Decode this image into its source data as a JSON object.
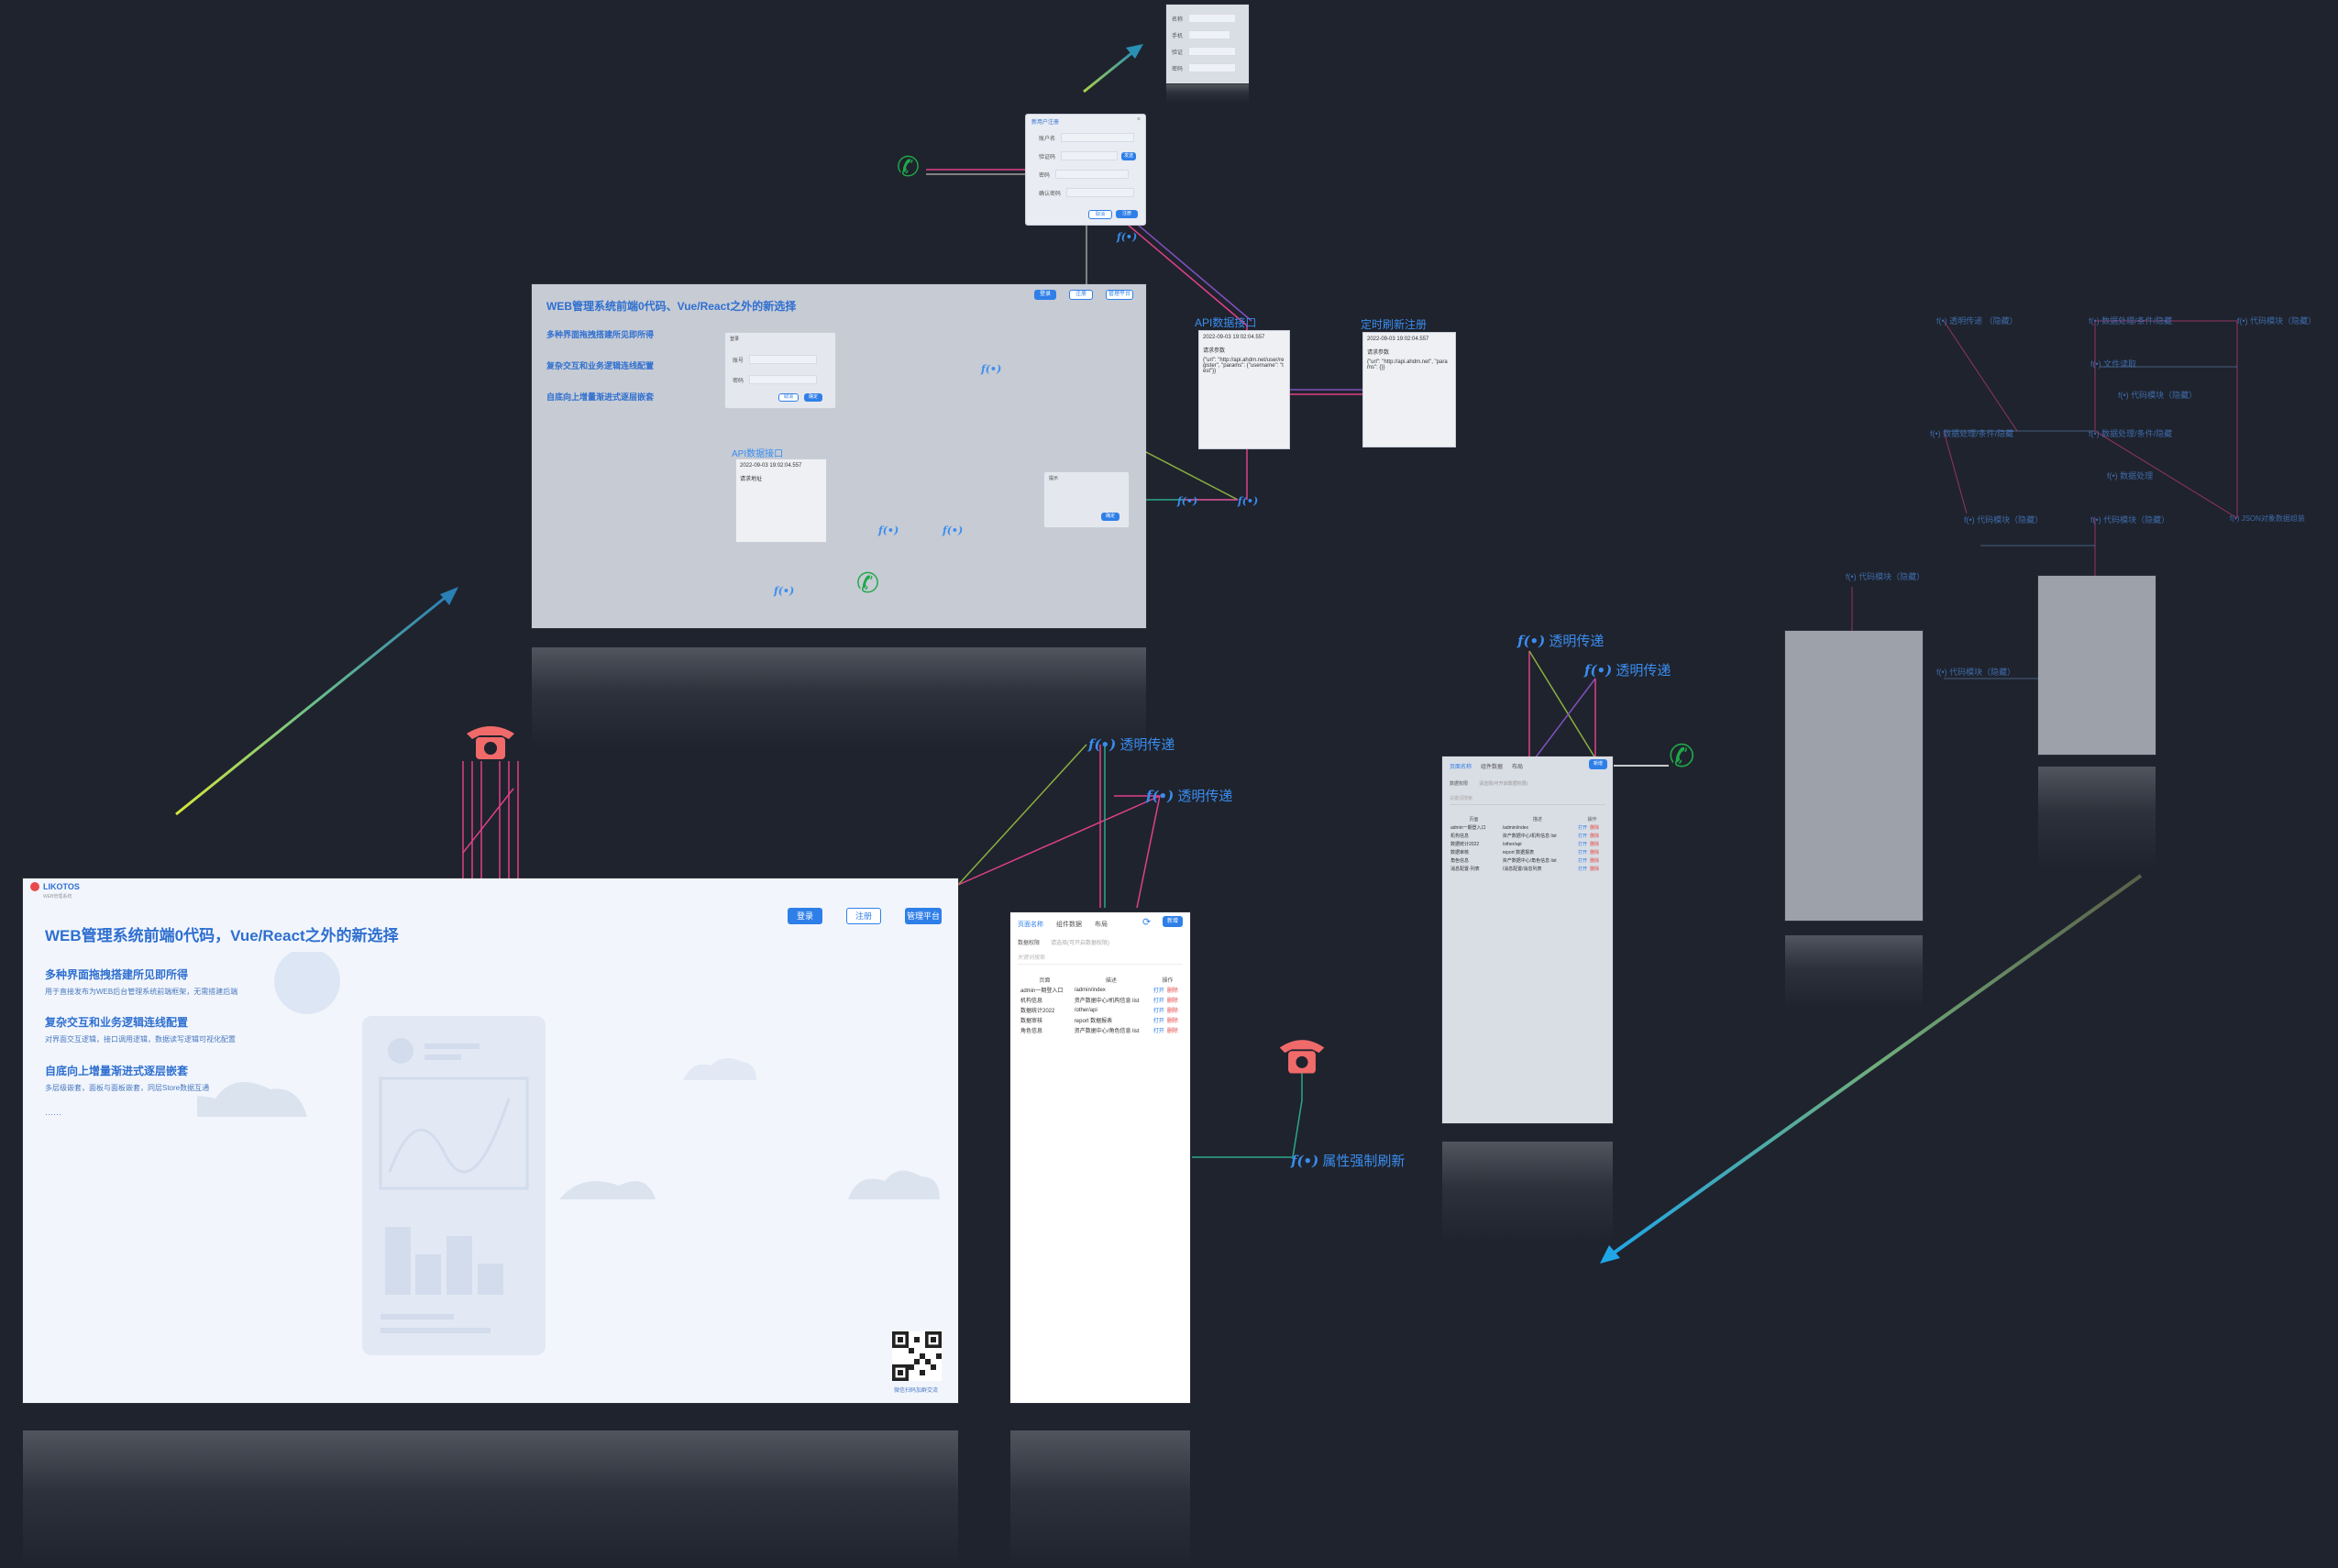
{
  "hero": {
    "logo": "LIKOTOS",
    "logo_sub": "WEB管理系统",
    "title": "WEB管理系统前端0代码，Vue/React之外的新选择",
    "buttons": {
      "login": "登录",
      "register": "注册",
      "console": "管理平台"
    },
    "features": [
      {
        "heading": "多种界面拖拽搭建所见即所得",
        "desc": "用于直接发布为WEB后台管理系统前端框架，无需搭建后端"
      },
      {
        "heading": "复杂交互和业务逻辑连线配置",
        "desc": "对界面交互逻辑，接口调用逻辑，数据读写逻辑可视化配置"
      },
      {
        "heading": "自底向上增量渐进式逐层嵌套",
        "desc": "多层级嵌套，面板与面板嵌套，同层Store数据互通"
      }
    ],
    "ellipsis": "……",
    "qr_caption": "微信扫码加群交流"
  },
  "wide_preview": {
    "title": "WEB管理系统前端0代码、Vue/React之外的新选择",
    "features": [
      "多种界面拖拽搭建所见即所得",
      "复杂交互和业务逻辑连线配置",
      "自底向上增量渐进式逐层嵌套"
    ],
    "buttons": [
      "登录",
      "注册",
      "管理平台"
    ],
    "login_dialog": {
      "title": "登录",
      "fields": [
        "账号",
        "密码"
      ],
      "cancel": "取消",
      "ok": "确定"
    },
    "api_title": "API数据接口",
    "api_time": "2022-09-03 19:02:04.557",
    "api_label": "请求地址",
    "confirm_dialog": {
      "title": "提示",
      "ok": "确定"
    }
  },
  "login_form": {
    "title": "新用户注册",
    "fields": [
      "账户名",
      "验证码",
      "密码",
      "确认密码"
    ],
    "send": "发送",
    "cancel": "取消",
    "submit": "注册"
  },
  "top_form": {
    "fields": [
      "名称",
      "手机",
      "验证",
      "密码"
    ]
  },
  "api_cards": [
    {
      "title": "API数据接口",
      "time": "2022-09-03 19:02:04.557",
      "label": "请求参数",
      "body": "{\"url\": \"http://api.ahdm.net/user/register\", \"params\": {\"username\": \"test\"}}"
    },
    {
      "title": "定时刷新注册",
      "time": "2022-09-03 19:02:04.557",
      "label": "请求参数",
      "body": "{\"url\": \"http://api.ahdm.net\", \"params\": {}}"
    }
  ],
  "flow_labels": {
    "transparent_pass": "透明传递",
    "force_refresh": "属性强制刷新"
  },
  "list_panel": {
    "tabs": [
      "页面名称",
      "组件数据",
      "布局"
    ],
    "add_button": "新增",
    "filter_label": "数据权限",
    "filter_placeholder": "请选择(可开启数据权限)",
    "search_placeholder": "关键词搜索",
    "columns": [
      "页面",
      "描述",
      "操作"
    ],
    "rows": [
      {
        "page": "admin一期登入口",
        "desc": "/admin/index",
        "op1": "打开",
        "op2": "删除"
      },
      {
        "page": "机构信息",
        "desc": "资产数据中心/机构信息 list",
        "op1": "打开",
        "op2": "删除"
      },
      {
        "page": "数据统计2022",
        "desc": "/other/api",
        "op1": "打开",
        "op2": "删除"
      },
      {
        "page": "数据审核",
        "desc": "report 数据报表",
        "op1": "打开",
        "op2": "删除"
      },
      {
        "page": "角色信息",
        "desc": "资产数据中心/角色信息 list",
        "op1": "打开",
        "op2": "删除"
      }
    ]
  },
  "right_list_panel": {
    "tabs": [
      "页面名称",
      "组件数据",
      "布局"
    ],
    "add_button": "新增",
    "filter_label": "数据权限",
    "filter_placeholder": "请选择(可开启数据权限)",
    "search_placeholder": "关键词搜索",
    "columns": [
      "页面",
      "描述",
      "操作"
    ],
    "rows": [
      {
        "page": "admin一期登入口",
        "desc": "/admin/index",
        "op1": "打开",
        "op2": "删除"
      },
      {
        "page": "机构信息",
        "desc": "资产数据中心/机构信息 list",
        "op1": "打开",
        "op2": "删除"
      },
      {
        "page": "数据统计2022",
        "desc": "/other/api",
        "op1": "打开",
        "op2": "删除"
      },
      {
        "page": "数据审核",
        "desc": "report 数据报表",
        "op1": "打开",
        "op2": "删除"
      },
      {
        "page": "角色信息",
        "desc": "资产数据中心/角色信息 list",
        "op1": "打开",
        "op2": "删除"
      },
      {
        "page": "消息配置-列表",
        "desc": "/消息配置/消息列表",
        "op1": "打开",
        "op2": "删除"
      }
    ]
  },
  "far_right_labels": [
    "f(•) 透明传递 （隐藏）",
    "f(•) 数据处理/条件/隐藏",
    "f(•) 代码模块（隐藏）",
    "f(•) 文件读取",
    "f(•) 代码模块（隐藏）",
    "f(•) 数据处理/条件/隐藏",
    "f(•) 数据处理/条件/隐藏",
    "f(•) 数据处理",
    "f(•) 代码模块（隐藏）",
    "f(•) 代码模块（隐藏）",
    "f(•) JSON对象数据组装",
    "f(•) 代码模块（隐藏）",
    "f(•) 代码模块（隐藏）"
  ],
  "colors": {
    "background": "#1f232d",
    "accent": "#2f7fe8",
    "pink_line": "#e0408a",
    "phone_red": "#f06a6a",
    "phone_green": "#1fa84a"
  }
}
